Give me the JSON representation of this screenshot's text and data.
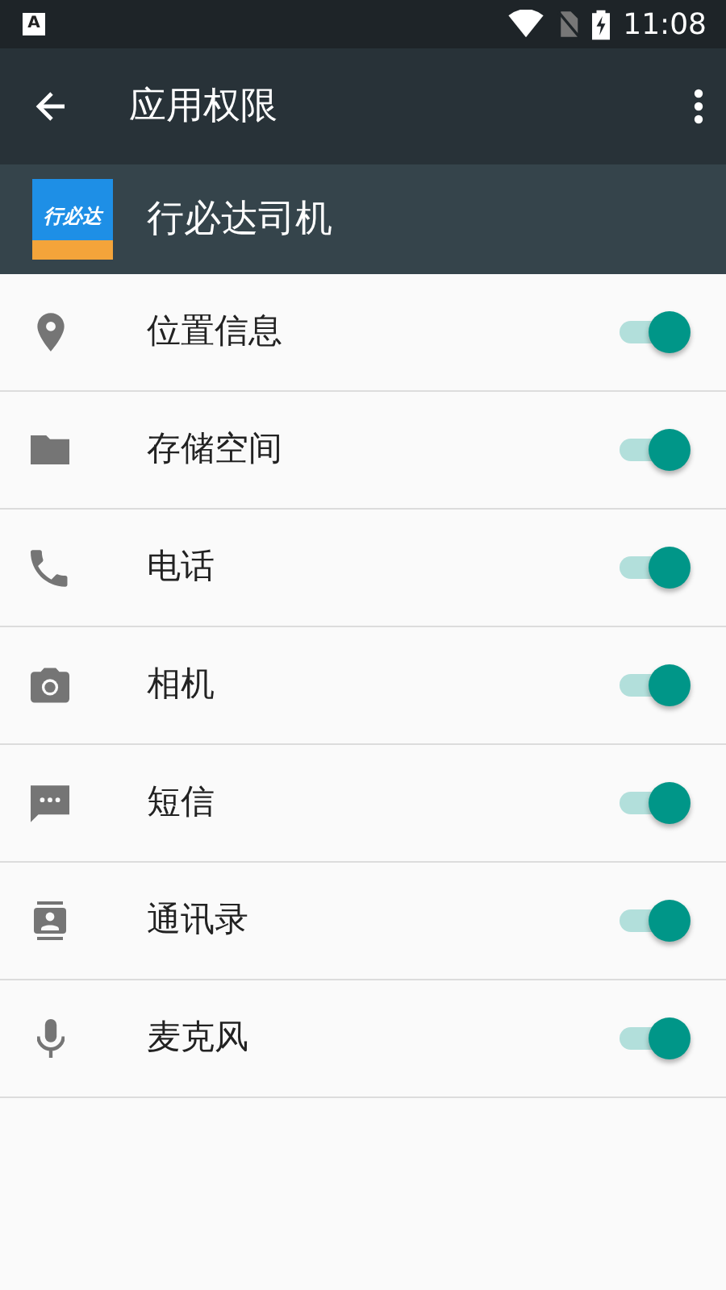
{
  "status_bar": {
    "notification_glyph": "A",
    "time": "11:08"
  },
  "toolbar": {
    "title": "应用权限"
  },
  "app": {
    "icon_text": "行必达",
    "name": "行必达司机"
  },
  "permissions": [
    {
      "kind": "location",
      "label": "位置信息",
      "on": true
    },
    {
      "kind": "storage",
      "label": "存储空间",
      "on": true
    },
    {
      "kind": "phone",
      "label": "电话",
      "on": true
    },
    {
      "kind": "camera",
      "label": "相机",
      "on": true
    },
    {
      "kind": "sms",
      "label": "短信",
      "on": true
    },
    {
      "kind": "contacts",
      "label": "通讯录",
      "on": true
    },
    {
      "kind": "microphone",
      "label": "麦克风",
      "on": true
    }
  ]
}
